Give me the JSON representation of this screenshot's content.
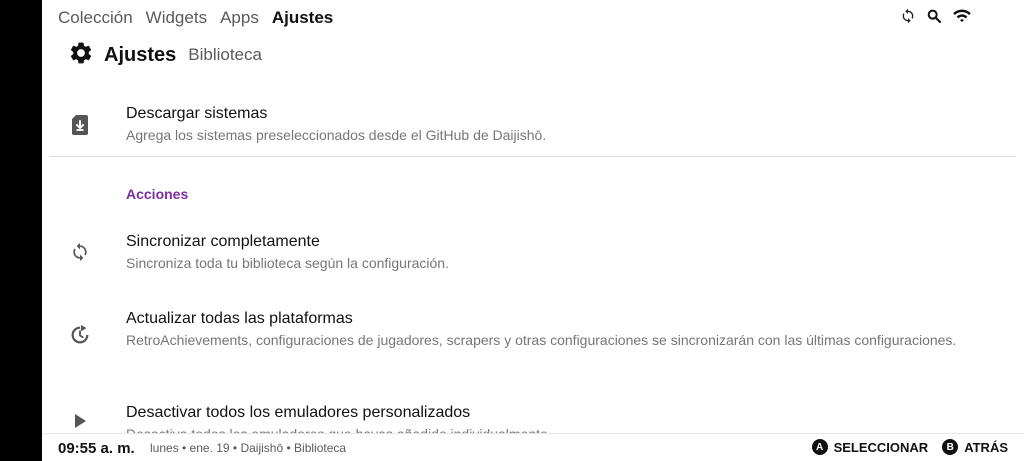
{
  "nav": {
    "tabs": [
      {
        "label": "Colección",
        "active": false
      },
      {
        "label": "Widgets",
        "active": false
      },
      {
        "label": "Apps",
        "active": false
      },
      {
        "label": "Ajustes",
        "active": true
      }
    ]
  },
  "top_icons": [
    "sync-icon",
    "search-icon",
    "wifi-icon"
  ],
  "header": {
    "icon": "gear-icon",
    "title": "Ajustes",
    "subtitle": "Biblioteca"
  },
  "items": {
    "download": {
      "icon": "sd-card-download-icon",
      "title": "Descargar sistemas",
      "desc": "Agrega los sistemas preseleccionados desde el GitHub de Daijishō."
    },
    "section_actions": "Acciones",
    "sync": {
      "icon": "sync-icon",
      "title": "Sincronizar completamente",
      "desc": "Sincroniza toda tu biblioteca según la configuración."
    },
    "update": {
      "icon": "refresh-icon",
      "title": "Actualizar todas las plataformas",
      "desc": "RetroAchievements, configuraciones de jugadores, scrapers y otras configuraciones se sincronizarán con las últimas configuraciones."
    },
    "disable": {
      "icon": "play-icon",
      "title": "Desactivar todos los emuladores personalizados",
      "desc": "Desactiva todos los emuladores que hayas añadido individualmente."
    }
  },
  "statusbar": {
    "time": "09:55 a. m.",
    "info": "lunes • ene. 19 • Daijishō • Biblioteca",
    "actions": [
      {
        "button": "A",
        "label": "SELECCIONAR"
      },
      {
        "button": "B",
        "label": "ATRÁS"
      }
    ]
  },
  "colors": {
    "accent": "#7b2fa0",
    "text_primary": "#111111",
    "text_secondary": "#767676",
    "divider": "#dcdcdc"
  }
}
